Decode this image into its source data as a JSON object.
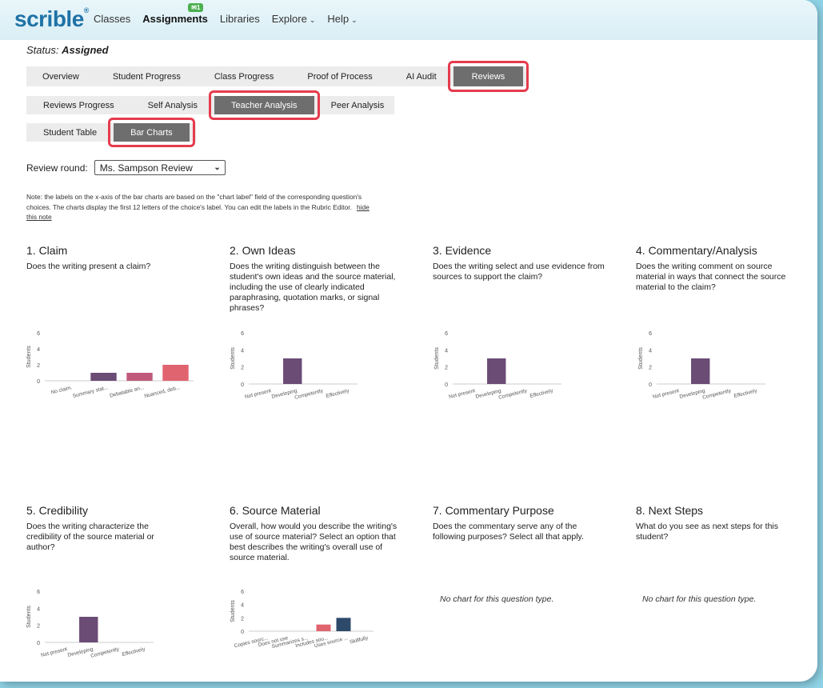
{
  "nav": {
    "logo": "scrible",
    "items": [
      "Classes",
      "Assignments",
      "Libraries",
      "Explore",
      "Help"
    ],
    "badge": "1"
  },
  "status": {
    "label": "Status:",
    "value": "Assigned"
  },
  "tabs_row1": [
    "Overview",
    "Student Progress",
    "Class Progress",
    "Proof of Process",
    "AI Audit",
    "Reviews"
  ],
  "tabs_row2": [
    "Reviews Progress",
    "Self Analysis",
    "Teacher Analysis",
    "Peer Analysis"
  ],
  "tabs_row3": [
    "Student Table",
    "Bar Charts"
  ],
  "review_round": {
    "label": "Review round:",
    "selected": "Ms. Sampson Review"
  },
  "note": {
    "text": "Note: the labels on the x-axis of the bar charts are based on the \"chart label\" field of the corresponding question's choices. The charts display the first 12 letters of the choice's label. You can edit the labels in the Rubric Editor.",
    "link": "hide this note"
  },
  "questions": [
    {
      "title": "1. Claim",
      "desc": "Does the writing present a claim?"
    },
    {
      "title": "2. Own Ideas",
      "desc": "Does the writing distinguish between the student's own ideas and the source material, including the use of clearly indicated paraphrasing, quotation marks, or signal phrases?"
    },
    {
      "title": "3. Evidence",
      "desc": "Does the writing select and use evidence from sources to support the claim?"
    },
    {
      "title": "4. Commentary/Analysis",
      "desc": "Does the writing comment on source material in ways that connect the source material to the claim?"
    },
    {
      "title": "5. Credibility",
      "desc": "Does the writing characterize the credibility of the source material or author?"
    },
    {
      "title": "6. Source Material",
      "desc": "Overall, how would you describe the writing's use of source material? Select an option that best describes the writing's overall use of source material."
    },
    {
      "title": "7. Commentary Purpose",
      "desc": "Does the commentary serve any of the following purposes? Select all that apply."
    },
    {
      "title": "8. Next Steps",
      "desc": "What do you see as next steps for this student?"
    }
  ],
  "no_chart_text": "No chart for this question type.",
  "colors": {
    "developing": "#6b4c75",
    "accent_red": "#e0646f",
    "dark_blue": "#2e4a6b",
    "highlight": "#e53b4c"
  },
  "chart_data": [
    {
      "type": "bar",
      "question": "1. Claim",
      "ylabel": "Students",
      "ylim": [
        0,
        6
      ],
      "yticks": [
        0,
        2,
        4,
        6
      ],
      "categories": [
        "No claim.",
        "Summary stat...",
        "Debatable an...",
        "Nuanced, deb..."
      ],
      "values": [
        0,
        1,
        1,
        2
      ],
      "colors": [
        "#6b4c75",
        "#6b4c75",
        "#c05a7a",
        "#e0646f"
      ]
    },
    {
      "type": "bar",
      "question": "2. Own Ideas",
      "ylabel": "Students",
      "ylim": [
        0,
        6
      ],
      "yticks": [
        0,
        2,
        4,
        6
      ],
      "categories": [
        "Not present",
        "Developing",
        "Competently",
        "Effectively"
      ],
      "values": [
        0,
        3,
        0,
        0
      ],
      "colors": [
        "#6b4c75",
        "#6b4c75",
        "#6b4c75",
        "#6b4c75"
      ]
    },
    {
      "type": "bar",
      "question": "3. Evidence",
      "ylabel": "Students",
      "ylim": [
        0,
        6
      ],
      "yticks": [
        0,
        2,
        4,
        6
      ],
      "categories": [
        "Not present",
        "Developing",
        "Competently",
        "Effectively"
      ],
      "values": [
        0,
        3,
        0,
        0
      ],
      "colors": [
        "#6b4c75",
        "#6b4c75",
        "#6b4c75",
        "#6b4c75"
      ]
    },
    {
      "type": "bar",
      "question": "4. Commentary/Analysis",
      "ylabel": "Students",
      "ylim": [
        0,
        6
      ],
      "yticks": [
        0,
        2,
        4,
        6
      ],
      "categories": [
        "Not present",
        "Developing",
        "Competently",
        "Effectively"
      ],
      "values": [
        0,
        3,
        0,
        0
      ],
      "colors": [
        "#6b4c75",
        "#6b4c75",
        "#6b4c75",
        "#6b4c75"
      ]
    },
    {
      "type": "bar",
      "question": "5. Credibility",
      "ylabel": "Students",
      "ylim": [
        0,
        6
      ],
      "yticks": [
        0,
        2,
        4,
        6
      ],
      "categories": [
        "Not present",
        "Developing",
        "Competently",
        "Effectively"
      ],
      "values": [
        0,
        3,
        0,
        0
      ],
      "colors": [
        "#6b4c75",
        "#6b4c75",
        "#6b4c75",
        "#6b4c75"
      ]
    },
    {
      "type": "bar",
      "question": "6. Source Material",
      "ylabel": "Students",
      "ylim": [
        0,
        6
      ],
      "yticks": [
        0,
        2,
        4,
        6
      ],
      "categories": [
        "Copies sourc...",
        "Does not use",
        "Summarizes s...",
        "Includes sou...",
        "Uses source ...",
        "Skillfully"
      ],
      "values": [
        0,
        0,
        0,
        1,
        2,
        0
      ],
      "colors": [
        "#6b4c75",
        "#6b4c75",
        "#6b4c75",
        "#e0646f",
        "#2e4a6b",
        "#2e4a6b"
      ]
    }
  ]
}
